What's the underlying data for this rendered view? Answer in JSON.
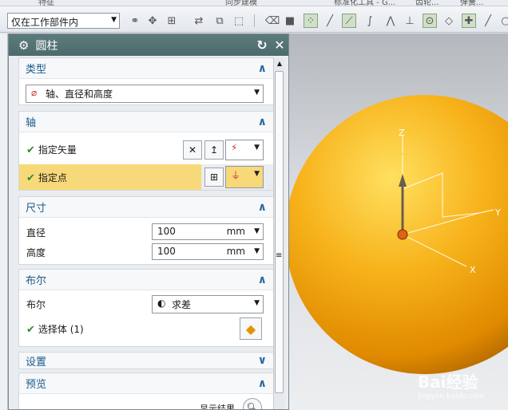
{
  "top_menu": [
    "特征",
    "同步建模",
    "标准化工具 - G...",
    "齿轮...",
    "弹簧..."
  ],
  "toolbar": {
    "selection_filter": "仅在工作部件内"
  },
  "dialog": {
    "title": "圆柱",
    "reset_icon": "reset-icon",
    "close_icon": "close-icon",
    "type": {
      "header": "类型",
      "value": "轴、直径和高度"
    },
    "axis": {
      "header": "轴",
      "specify_vector": "指定矢量",
      "specify_point": "指定点"
    },
    "dimensions": {
      "header": "尺寸",
      "diameter_label": "直径",
      "diameter_value": "100",
      "diameter_unit": "mm",
      "height_label": "高度",
      "height_value": "100",
      "height_unit": "mm"
    },
    "boolean": {
      "header": "布尔",
      "label": "布尔",
      "value": "求差",
      "select_body": "选择体 (1)"
    },
    "settings": {
      "header": "设置"
    },
    "preview": {
      "header": "预览",
      "show_result": "显示结果"
    }
  },
  "viewport": {
    "axis_labels": {
      "z": "Z",
      "y": "Y",
      "x": "X"
    },
    "sphere_color": "#f5a300",
    "watermark": "Bai经验",
    "watermark_sub": "jingyan.baidu.com"
  },
  "colors": {
    "title_bar": "#557373",
    "section_header": "#1c5a8a",
    "highlight": "#f8d97a",
    "check": "#2e8b2e"
  }
}
